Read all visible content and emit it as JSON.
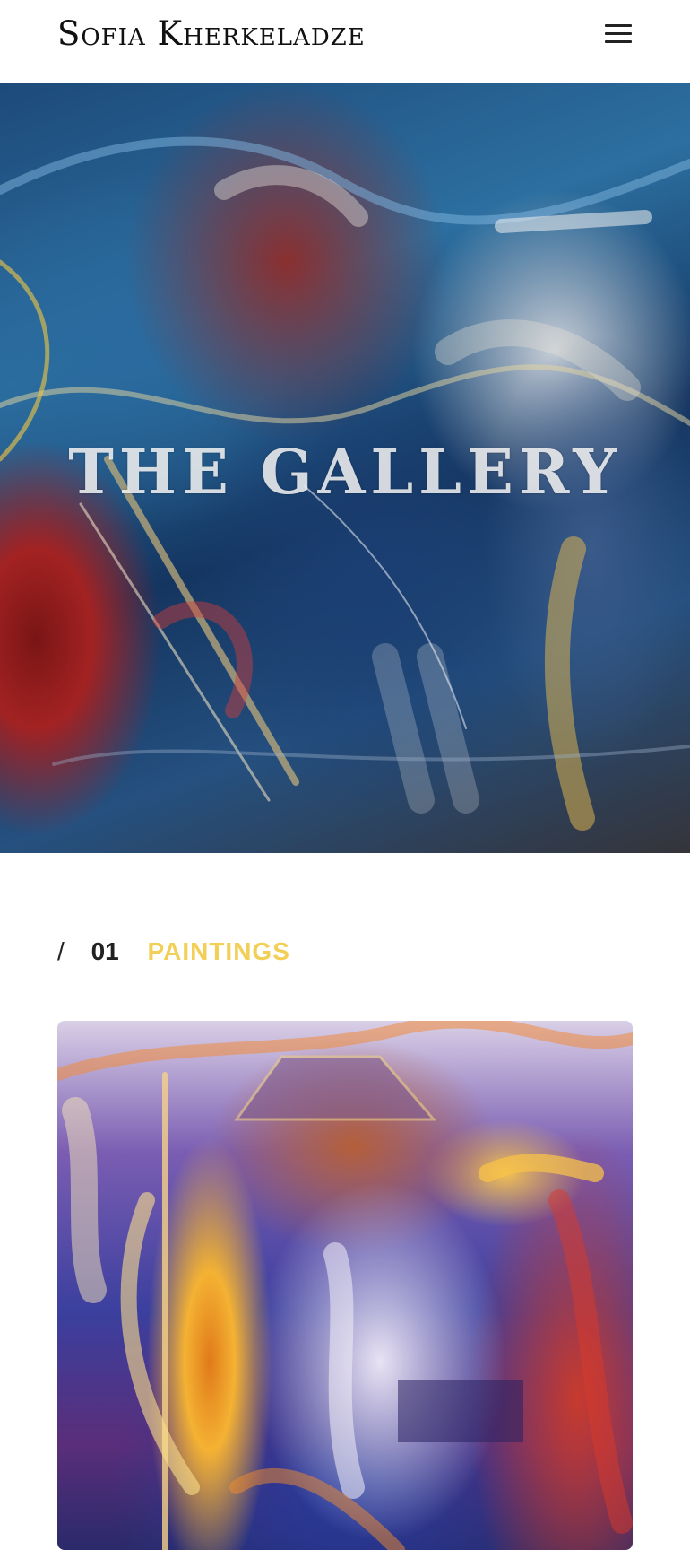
{
  "header": {
    "site_title": "Sofia Kherkeladze",
    "menu_icon": "hamburger-menu-icon"
  },
  "hero": {
    "title": "THE GALLERY",
    "image": "jazz-band-painting"
  },
  "section": {
    "slash": "/",
    "number": "01",
    "label": "PAINTINGS"
  },
  "gallery": {
    "items": [
      {
        "image": "jazz-musicians-painting"
      }
    ]
  },
  "colors": {
    "accent": "#f2cf56",
    "text": "#222222",
    "background": "#ffffff"
  }
}
